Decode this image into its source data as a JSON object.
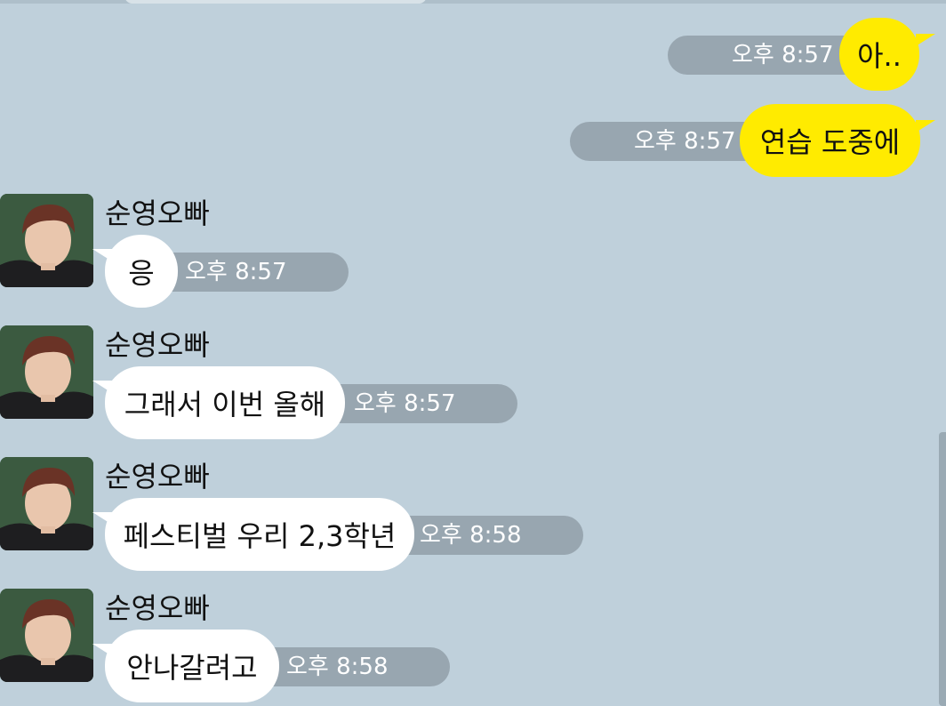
{
  "chat": {
    "contact_name": "순영오빠",
    "sent": [
      {
        "text": "아..",
        "time": "오후 8:57"
      },
      {
        "text": "연습 도중에",
        "time": "오후 8:57"
      }
    ],
    "received": [
      {
        "sender": "순영오빠",
        "text": "응",
        "time": "오후 8:57"
      },
      {
        "sender": "순영오빠",
        "text": "그래서 이번 올해",
        "time": "오후 8:57"
      },
      {
        "sender": "순영오빠",
        "text": "페스티벌 우리 2,3학년",
        "time": "오후 8:58"
      },
      {
        "sender": "순영오빠",
        "text": "안나갈려고",
        "time": "오후 8:58"
      }
    ]
  },
  "colors": {
    "background": "#bfd0db",
    "my_bubble": "#ffeb00",
    "their_bubble": "#ffffff",
    "time_pill": "#98a6b0"
  },
  "icons": {
    "avatar": "contact-avatar-photo"
  }
}
